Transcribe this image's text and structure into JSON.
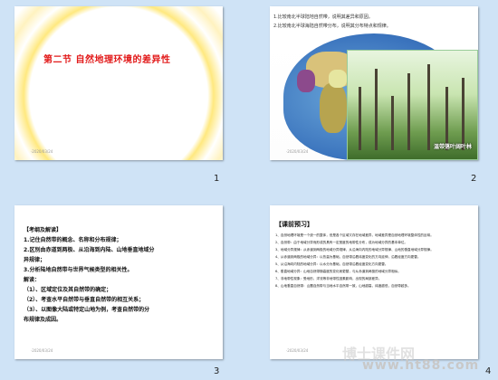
{
  "slides": [
    {
      "number": "1",
      "title": "第二节   自然地理环境的差异性",
      "footer": "·2020/03/24"
    },
    {
      "number": "2",
      "lines": [
        "1.比较南北半球陆地自然带，说明其差异和原因。",
        "2.比较南北半球海陆自然带分布，说明其分布特点和规律。"
      ],
      "caption": "温带落叶阔叶林",
      "footer": "·2020/03/24"
    },
    {
      "number": "3",
      "heading": "【考纲及解读】",
      "lines": [
        "1.记住自然带的概念、名称和分布规律；",
        "2.区别由赤道到两极、从沿海到内陆、山地垂直地域分",
        "异规律；",
        "3.分析陆地自然带与世界气候类型的相关性。",
        "解读：",
        "（1）、区域定位及其自然带的确定；",
        "（2）、考查水平自然带与垂直自然带的相互关系；",
        "（3）、以图像大陆或特定山地为例，考查自然带的分",
        "布规律及成因。"
      ],
      "footer": "·2020/03/24"
    },
    {
      "number": "4",
      "heading": "【课前预习】",
      "items": [
        "1、自然地理环境是一个统一的整体，但是各个区域又存在地域差异，地域差异是自然地理环境整体性的反映。",
        "2、自然带：由于地域分异而形成的具有一定宽度的地带性分布，成为地域分异的基本单位。",
        "3、地域分异规律：从赤道到两极的地域分异规律、从沿海向内陆的地域分异规律、山地的垂直地域分异规律。",
        "4、从赤道到两极的地域分异：以热量为基础，自然带沿着纬度变化的方向延伸，沿着经度方向更替。",
        "5、从沿海向内陆的地域分异：以水分为基础，自然带沿着经度变化方向更替。",
        "6、垂直地域分异：山地自然带随高度的变化而更替，与从赤道到两极的地域分异相似。",
        "7、非地带性现象：受地形、洋流等非地带性因素影响，出现的局部差异。",
        "8、山地垂直自然带：山麓自然带与当地水平自然带一致，山地越高，纬度越低，自然带越多。"
      ],
      "footer": "·2020/03/24"
    }
  ],
  "watermark": "www.ht88.com",
  "watermark_cn": "博士课件网"
}
